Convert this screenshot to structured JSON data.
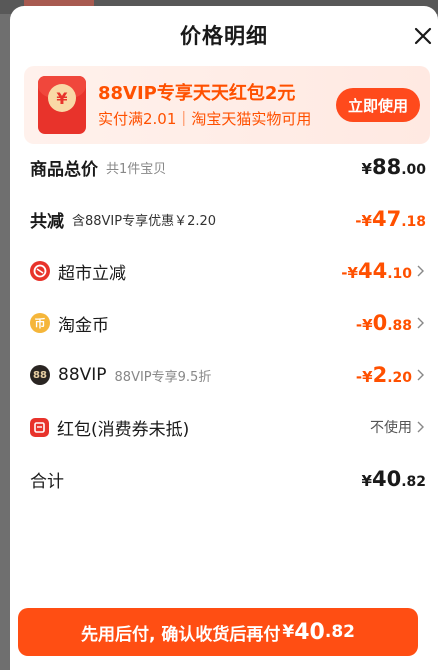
{
  "header": {
    "title": "价格明细"
  },
  "promo": {
    "title": "88VIP专享天天红包2元",
    "subtitle": "实付满2.01｜淘宝天猫实物可用",
    "button": "立即使用",
    "envelope_glyph": "¥"
  },
  "rows": {
    "total": {
      "label": "商品总价",
      "hint": "共1件宝贝",
      "yen": "¥",
      "int": "88",
      "dec": ".00"
    },
    "discount": {
      "label": "共减",
      "hint": "含88VIP专享优惠￥2.20",
      "yen": "-¥",
      "int": "47",
      "dec": ".18"
    },
    "supermarket": {
      "label": "超市立减",
      "yen": "-¥",
      "int": "44",
      "dec": ".10"
    },
    "taojinbi": {
      "label": "淘金币",
      "coin_glyph": "币",
      "yen": "-¥",
      "int": "0",
      "dec": ".88"
    },
    "vip": {
      "label": "88VIP",
      "badge": "88",
      "hint": "88VIP专享9.5折",
      "yen": "-¥",
      "int": "2",
      "dec": ".20"
    },
    "redpacket": {
      "label": "红包(消费券未抵)",
      "value": "不使用"
    },
    "sum": {
      "label": "合计",
      "yen": "¥",
      "int": "40",
      "dec": ".82"
    }
  },
  "bottom_button": {
    "text": "先用后付, 确认收货后再付",
    "yen": "¥",
    "int": "40",
    "dec": ".82"
  },
  "colors": {
    "accent": "#ff5000",
    "button": "#ff4e13"
  }
}
